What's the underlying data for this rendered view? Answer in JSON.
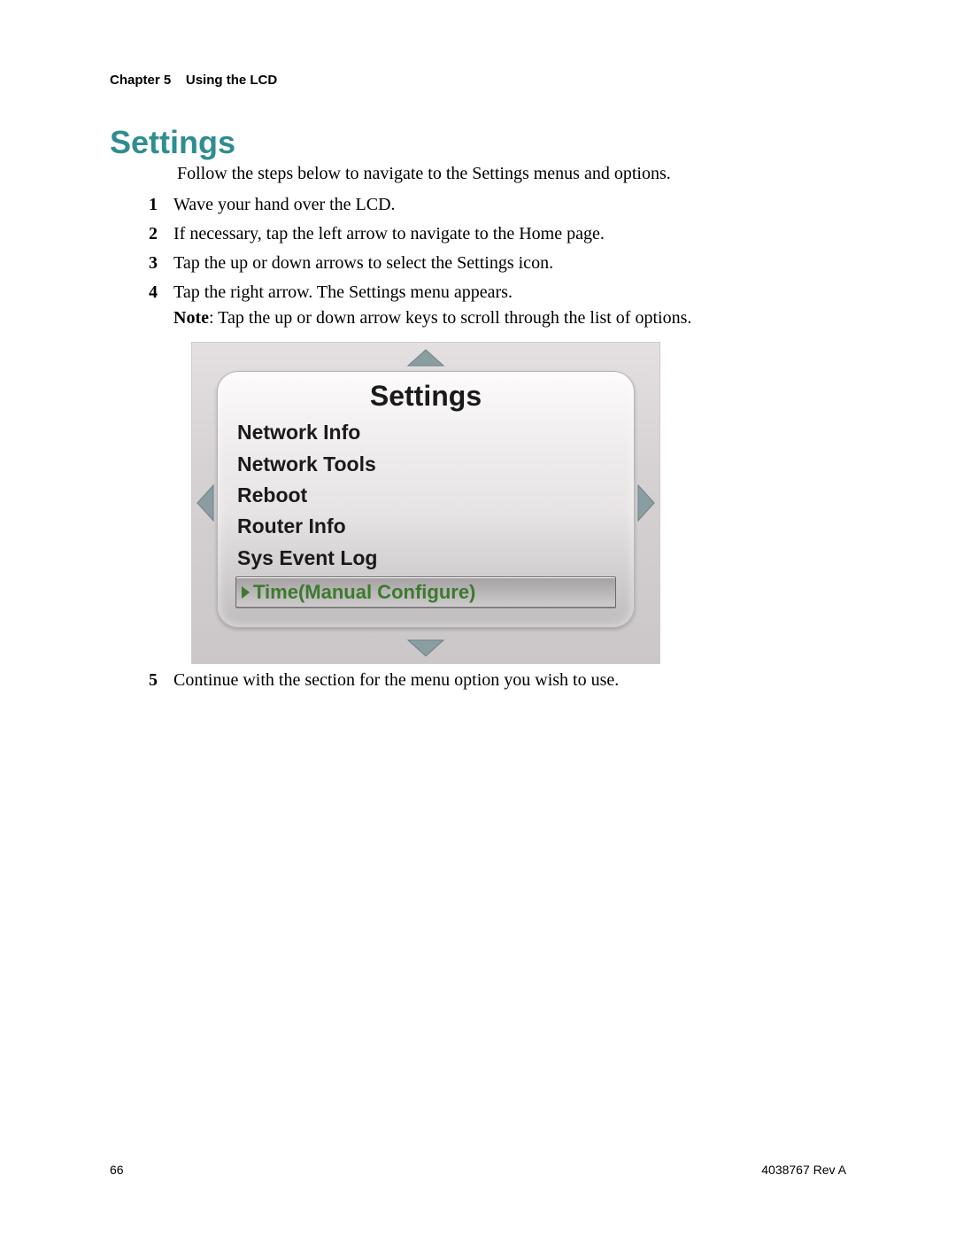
{
  "header": {
    "chapter": "Chapter 5",
    "title": "Using the LCD"
  },
  "section_title": "Settings",
  "intro": "Follow the steps below to navigate to the Settings menus and options.",
  "steps": [
    "Wave your hand over the LCD.",
    "If necessary, tap the left arrow to navigate to the Home page.",
    "Tap the up or down arrows to select the Settings icon.",
    "Tap the right arrow. The Settings menu appears.",
    "Continue with the section for the menu option you wish to use."
  ],
  "note": {
    "label": "Note",
    "text": ": Tap the up or down arrow keys to scroll through the list of options."
  },
  "lcd": {
    "title": "Settings",
    "items": [
      "Network Info",
      "Network Tools",
      "Reboot",
      "Router Info",
      "Sys Event Log"
    ],
    "selected": "Time(Manual Configure)"
  },
  "footer": {
    "page": "66",
    "doc": "4038767 Rev A"
  },
  "colors": {
    "accent": "#2f8d91",
    "selected_text": "#3c7a2e",
    "arrow": "#8a9ea2"
  }
}
